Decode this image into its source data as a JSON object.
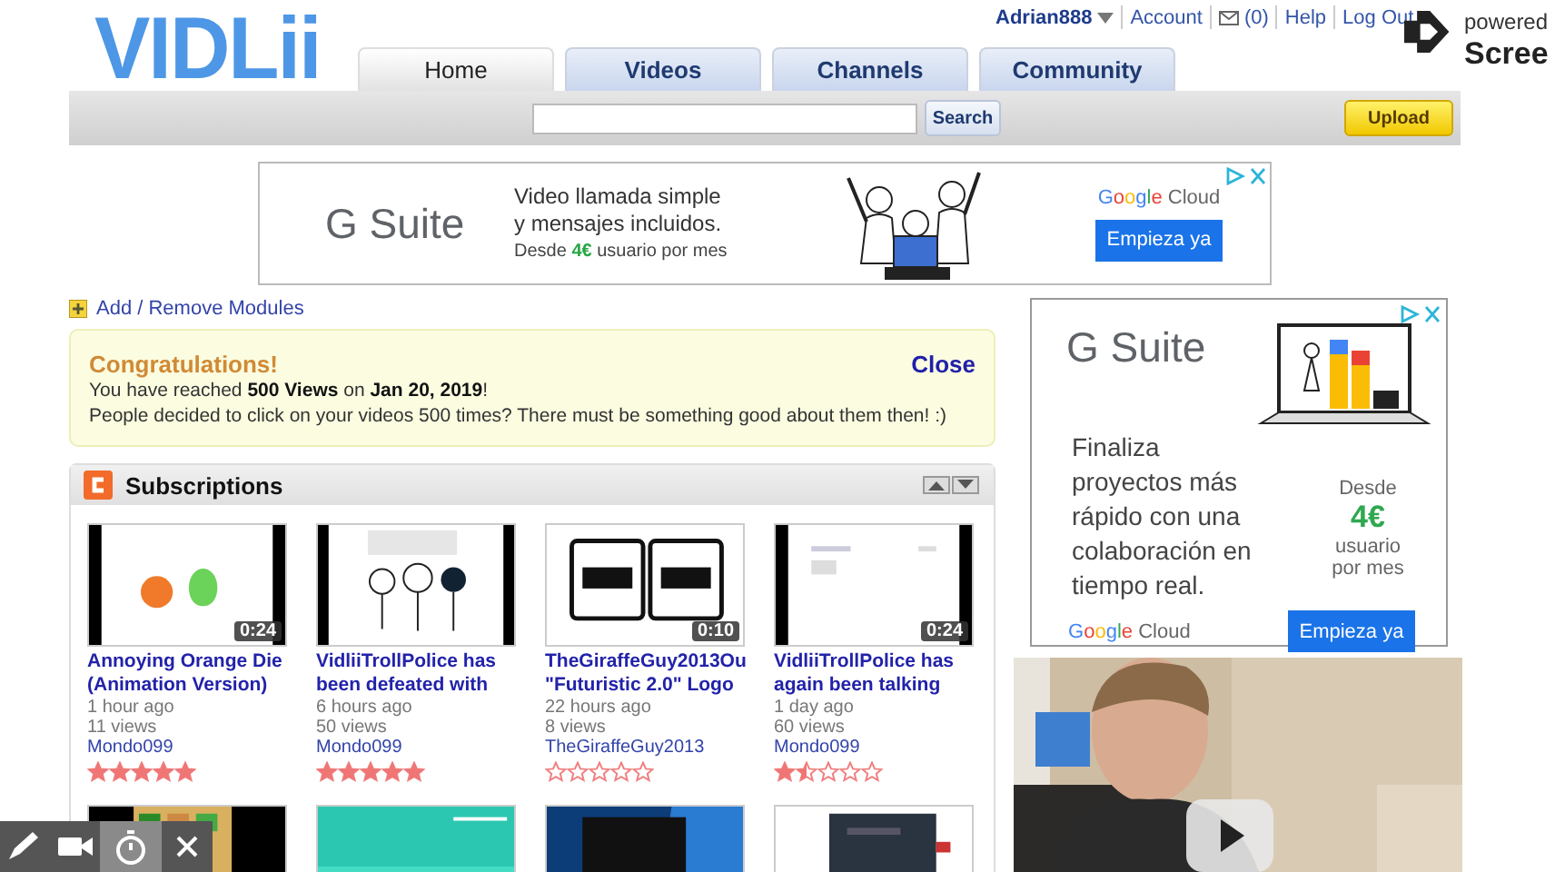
{
  "header": {
    "logo": "VIDLii",
    "user": "Adrian888",
    "links": [
      {
        "label": "Account",
        "kind": "link"
      },
      {
        "label": "(0)",
        "kind": "mail"
      },
      {
        "label": "Help",
        "kind": "link"
      },
      {
        "label": "Log Out",
        "kind": "link"
      }
    ]
  },
  "tabs": [
    {
      "label": "Home",
      "selected": true
    },
    {
      "label": "Videos",
      "selected": false
    },
    {
      "label": "Channels",
      "selected": false
    },
    {
      "label": "Community",
      "selected": false
    }
  ],
  "search": {
    "button": "Search"
  },
  "upload": "Upload",
  "banner_ad": {
    "brand": "G Suite",
    "lines": [
      "Video llamada simple",
      "y mensajes incluidos."
    ],
    "price_prefix": "Desde",
    "price": "4€",
    "price_suffix": "usuario por mes",
    "cloud_brand": "Google",
    "cloud": "Cloud",
    "cta": "Empieza ya"
  },
  "modules_link": "Add / Remove Modules",
  "notice": {
    "title": "Congratulations!",
    "close": "Close",
    "lines": [
      "You have reached **500 Views** on **Jan 20, 2019**!",
      "People decided to click on your videos 500 times? There must be something good about them then! :)"
    ]
  },
  "subscriptions": {
    "title": "Subscriptions",
    "videos": [
      {
        "kind": "video",
        "duration": "0:24",
        "title": [
          "Annoying Orange Die",
          "(Animation Version)"
        ],
        "age": "1 hour ago",
        "views": "11 views",
        "author": "Mondo099",
        "stars": 5
      },
      {
        "kind": "video",
        "title": [
          "VidliiTrollPolice has",
          "been defeated with"
        ],
        "age": "6 hours ago",
        "views": "50 views",
        "author": "Mondo099",
        "stars": 5
      },
      {
        "kind": "video",
        "duration": "0:10",
        "title": [
          "TheGiraffeGuy2013Ou",
          "\"Futuristic 2.0\" Logo"
        ],
        "age": "22 hours ago",
        "views": "8 views",
        "author": "TheGiraffeGuy2013",
        "stars": 0
      },
      {
        "kind": "video",
        "duration": "0:24",
        "title": [
          "VidliiTrollPolice has",
          "again been talking"
        ],
        "age": "1 day ago",
        "views": "60 views",
        "author": "Mondo099",
        "stars": 1.5
      },
      {
        "kind": "thumb"
      },
      {
        "kind": "thumb"
      },
      {
        "kind": "thumb"
      },
      {
        "kind": "thumb"
      }
    ]
  },
  "side_ad": {
    "brand": "G Suite",
    "lines": [
      "Finaliza",
      "proyectos más",
      "rápido con una",
      "colaboración en",
      "tiempo real."
    ],
    "price_prefix": "Desde",
    "price": "4€",
    "price_suffix": [
      "usuario",
      "por mes"
    ],
    "cloud_brand": "Google",
    "cloud": "Cloud",
    "cta": "Empieza ya"
  },
  "recorder": {
    "powered": "powered",
    "brand": "Scree"
  }
}
